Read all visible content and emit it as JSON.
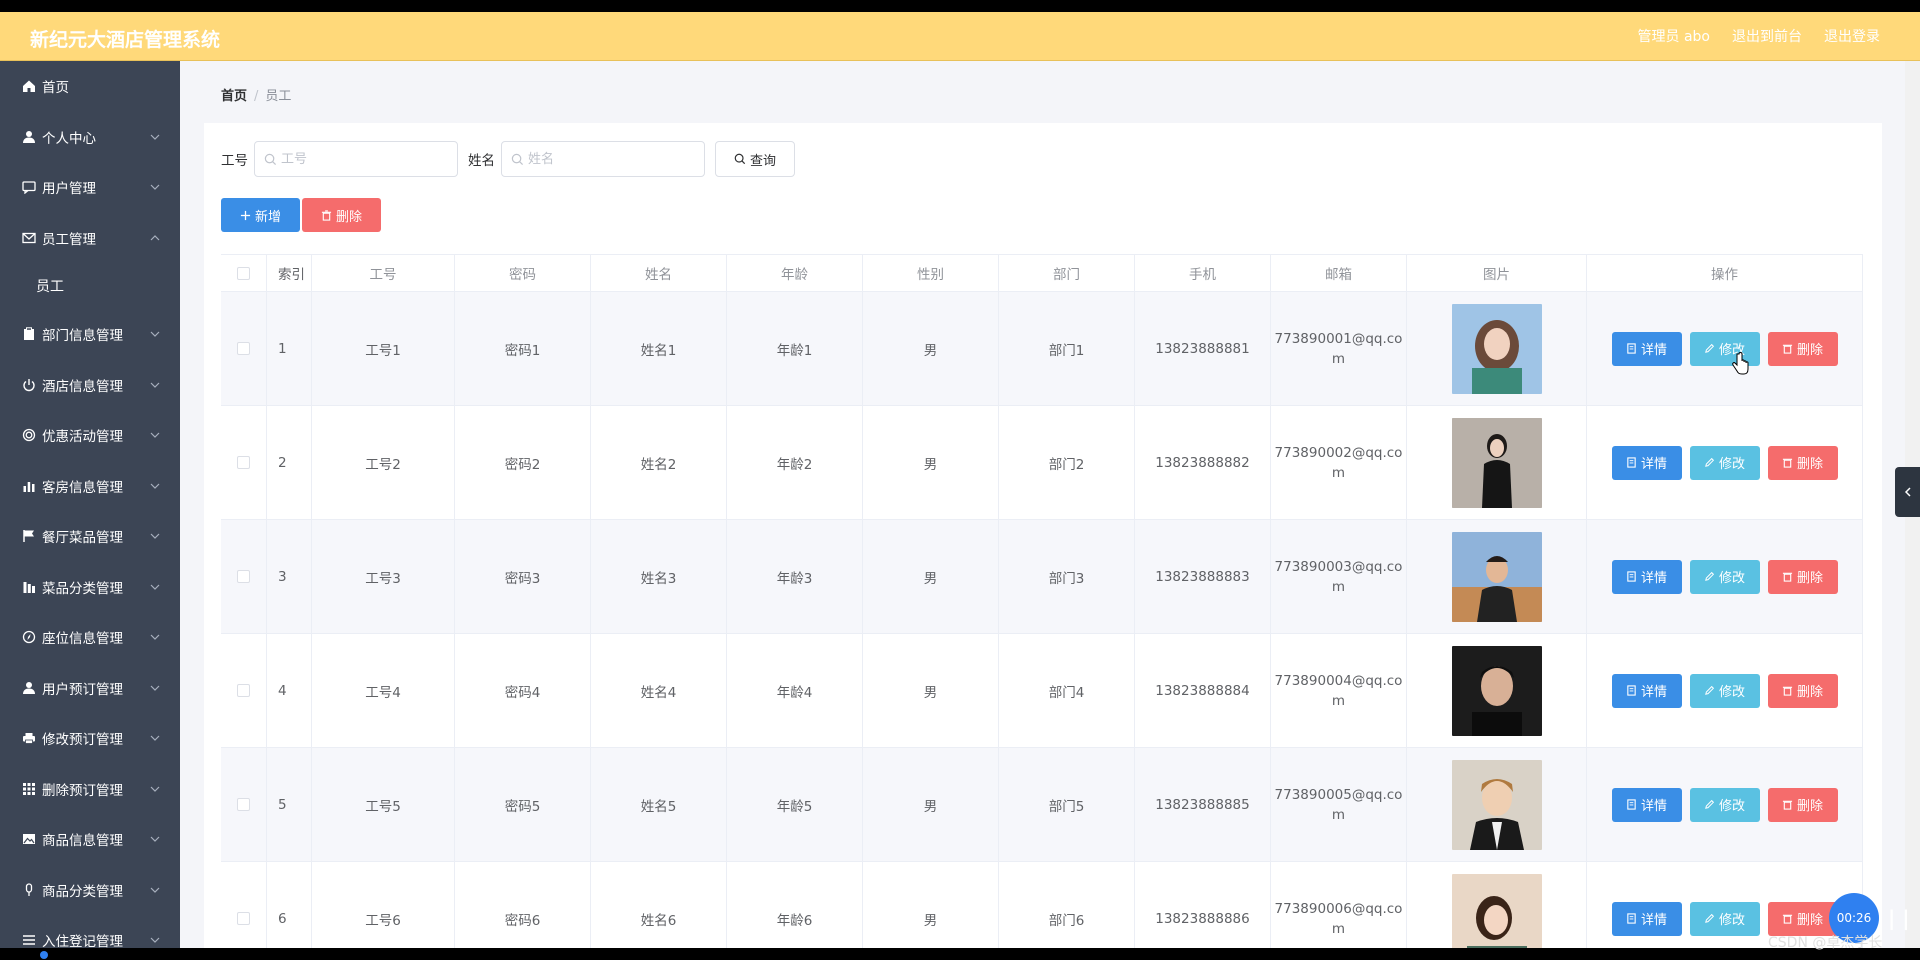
{
  "header": {
    "brand": "新纪元大酒店管理系统",
    "admin": "管理员 abo",
    "to_front": "退出到前台",
    "logout": "退出登录"
  },
  "sidebar": {
    "items": [
      {
        "label": "首页",
        "icon": "home-icon",
        "chevron": false
      },
      {
        "label": "个人中心",
        "icon": "user-icon",
        "chevron": true
      },
      {
        "label": "用户管理",
        "icon": "chat-icon",
        "chevron": true
      },
      {
        "label": "员工管理",
        "icon": "mail-icon",
        "chevron": true,
        "expanded": true
      },
      {
        "label": "部门信息管理",
        "icon": "clipboard-icon",
        "chevron": true
      },
      {
        "label": "酒店信息管理",
        "icon": "power-icon",
        "chevron": true
      },
      {
        "label": "优惠活动管理",
        "icon": "target-icon",
        "chevron": true
      },
      {
        "label": "客房信息管理",
        "icon": "bar-chart-icon",
        "chevron": true
      },
      {
        "label": "餐厅菜品管理",
        "icon": "flag-icon",
        "chevron": true
      },
      {
        "label": "菜品分类管理",
        "icon": "columns-icon",
        "chevron": true
      },
      {
        "label": "座位信息管理",
        "icon": "compass-icon",
        "chevron": true
      },
      {
        "label": "用户预订管理",
        "icon": "user-icon",
        "chevron": true
      },
      {
        "label": "修改预订管理",
        "icon": "printer-icon",
        "chevron": true
      },
      {
        "label": "删除预订管理",
        "icon": "grid-icon",
        "chevron": true
      },
      {
        "label": "商品信息管理",
        "icon": "picture-icon",
        "chevron": true
      },
      {
        "label": "商品分类管理",
        "icon": "mic-icon",
        "chevron": true
      },
      {
        "label": "入住登记管理",
        "icon": "list-icon",
        "chevron": true
      }
    ],
    "sub_item": "员工"
  },
  "breadcrumb": {
    "home": "首页",
    "sep": "/",
    "current": "员工"
  },
  "search": {
    "no_label": "工号",
    "no_placeholder": "工号",
    "name_label": "姓名",
    "name_placeholder": "姓名",
    "query": "查询"
  },
  "actions": {
    "add": "新增",
    "delete": "删除"
  },
  "table": {
    "headers": [
      "索引",
      "工号",
      "密码",
      "姓名",
      "年龄",
      "性别",
      "部门",
      "手机",
      "邮箱",
      "图片",
      "操作"
    ],
    "rows": [
      {
        "idx": "1",
        "no": "工号1",
        "pw": "密码1",
        "name": "姓名1",
        "age": "年龄1",
        "sex": "男",
        "dept": "部门1",
        "phone": "13823888881",
        "mail": "773890001@qq.com"
      },
      {
        "idx": "2",
        "no": "工号2",
        "pw": "密码2",
        "name": "姓名2",
        "age": "年龄2",
        "sex": "男",
        "dept": "部门2",
        "phone": "13823888882",
        "mail": "773890002@qq.com"
      },
      {
        "idx": "3",
        "no": "工号3",
        "pw": "密码3",
        "name": "姓名3",
        "age": "年龄3",
        "sex": "男",
        "dept": "部门3",
        "phone": "13823888883",
        "mail": "773890003@qq.com"
      },
      {
        "idx": "4",
        "no": "工号4",
        "pw": "密码4",
        "name": "姓名4",
        "age": "年龄4",
        "sex": "男",
        "dept": "部门4",
        "phone": "13823888884",
        "mail": "773890004@qq.com"
      },
      {
        "idx": "5",
        "no": "工号5",
        "pw": "密码5",
        "name": "姓名5",
        "age": "年龄5",
        "sex": "男",
        "dept": "部门5",
        "phone": "13823888885",
        "mail": "773890005@qq.com"
      },
      {
        "idx": "6",
        "no": "工号6",
        "pw": "密码6",
        "name": "姓名6",
        "age": "年龄6",
        "sex": "男",
        "dept": "部门6",
        "phone": "13823888886",
        "mail": "773890006@qq.com"
      }
    ],
    "op_detail": "详情",
    "op_edit": "修改",
    "op_delete": "删除"
  },
  "overlay": {
    "timer": "00:26",
    "pause": "| |",
    "watermark": "CSDN @卓杰学长"
  },
  "colors": {
    "header_bg": "#ffd97a",
    "sidebar_bg": "#3c4555",
    "primary": "#3a8ee6",
    "info": "#5ac1e2",
    "danger": "#f56c6c"
  }
}
